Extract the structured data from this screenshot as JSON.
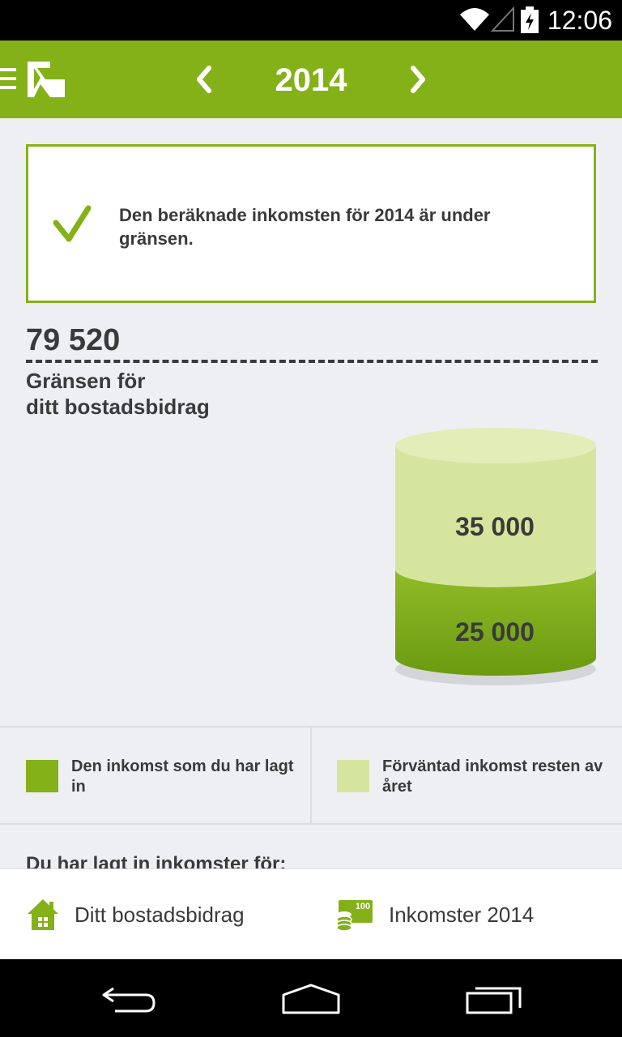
{
  "status_bar": {
    "time": "12:06"
  },
  "header": {
    "year": "2014"
  },
  "info_card": {
    "message": "Den beräknade inkomsten för 2014 är under gränsen."
  },
  "limit": {
    "value": "79 520",
    "label_line1": "Gränsen för",
    "label_line2": "ditt bostadsbidrag"
  },
  "chart_data": {
    "type": "bar",
    "series": [
      {
        "value": 25000,
        "label": "25 000",
        "color": "#84b118"
      },
      {
        "value": 35000,
        "label": "35 000",
        "color": "#d6e59e"
      }
    ],
    "stacked": true
  },
  "legend": {
    "items": [
      {
        "label": "Den inkomst som du har lagt in",
        "color": "#84b118"
      },
      {
        "label": "Förväntad inkomst resten av året",
        "color": "#d6e59e"
      }
    ]
  },
  "section": {
    "heading": "Du har lagt in inkomster för:"
  },
  "bottom_nav": {
    "home_label": "Ditt bostadsbidrag",
    "income_label": "Inkomster 2014",
    "income_badge": "100"
  },
  "colors": {
    "brand": "#84b118",
    "light": "#d6e59e"
  }
}
